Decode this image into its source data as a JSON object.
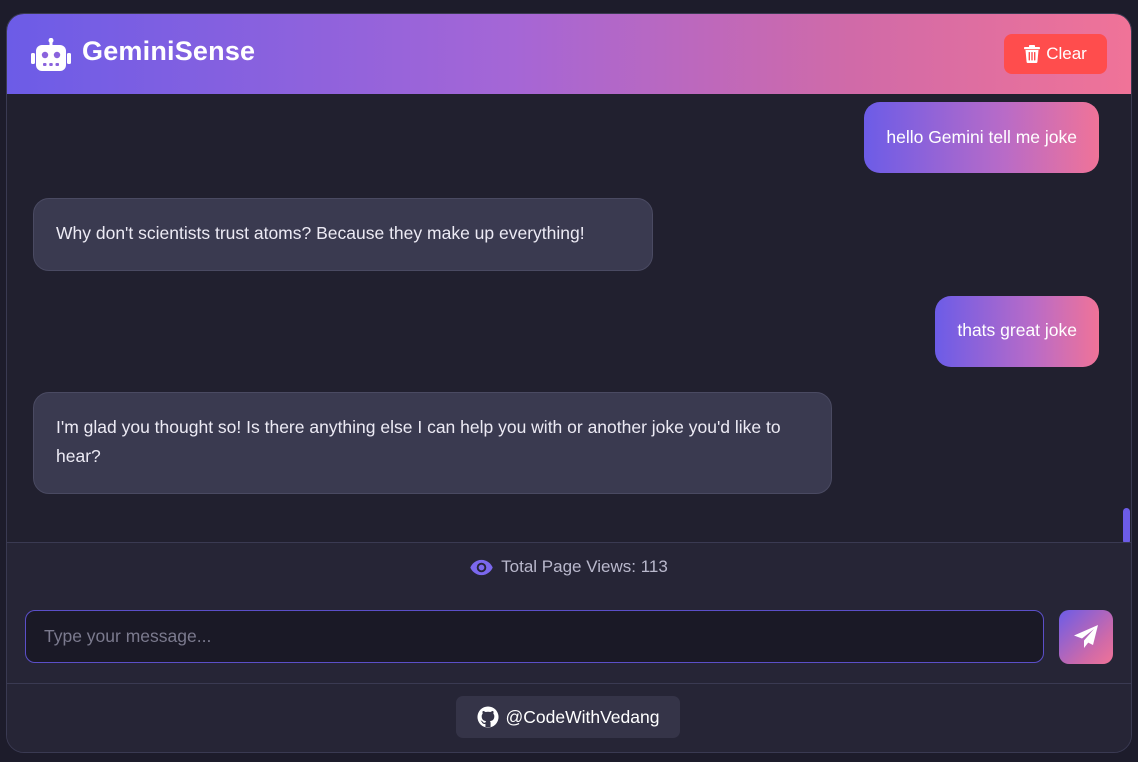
{
  "header": {
    "title": "GeminiSense",
    "logo_icon": "robot-icon",
    "clear_label": "Clear",
    "clear_icon": "trash-icon"
  },
  "colors": {
    "header_gradient_start": "#6c5ce7",
    "header_gradient_end": "#f07398",
    "clear_button": "#ff4d4d",
    "background": "#21202f",
    "bot_bubble": "#3a3a50"
  },
  "messages": [
    {
      "role": "user",
      "text": "hello Gemini tell me joke"
    },
    {
      "role": "bot",
      "text": "Why don't scientists trust atoms? Because they make up everything!"
    },
    {
      "role": "user",
      "text": "thats great joke"
    },
    {
      "role": "bot",
      "text": "I'm glad you thought so! Is there anything else I can help you with or another joke you'd like to hear?"
    }
  ],
  "views": {
    "label": "Total Page Views: 113",
    "icon": "eye-icon"
  },
  "input": {
    "placeholder": "Type your message...",
    "value": "",
    "send_icon": "paper-plane-icon"
  },
  "footer": {
    "github_label": "@CodeWithVedang",
    "github_icon": "github-icon"
  }
}
